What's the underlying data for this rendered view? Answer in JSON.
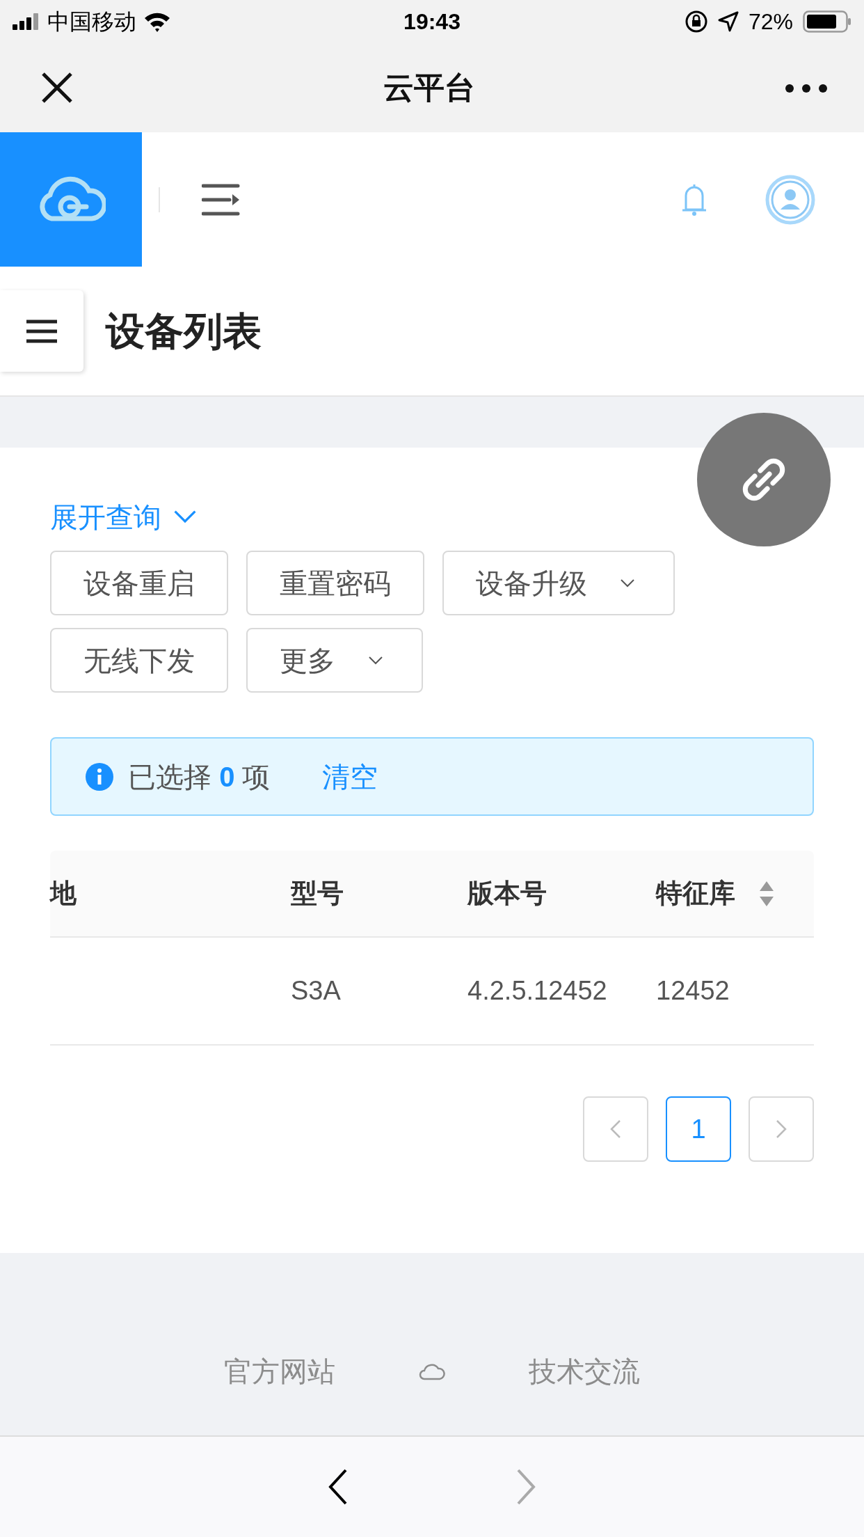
{
  "status_bar": {
    "carrier": "中国移动",
    "time": "19:43",
    "battery": "72%"
  },
  "nav_bar": {
    "title": "云平台"
  },
  "page": {
    "title": "设备列表"
  },
  "query_toggle": {
    "label": "展开查询",
    "expanded": false
  },
  "actions": [
    {
      "label": "设备重启",
      "kind": "button"
    },
    {
      "label": "重置密码",
      "kind": "button"
    },
    {
      "label": "设备升级",
      "kind": "dropdown"
    },
    {
      "label": "无线下发",
      "kind": "button"
    },
    {
      "label": "更多",
      "kind": "dropdown"
    }
  ],
  "selection_alert": {
    "prefix": "已选择",
    "count": "0",
    "suffix": "项",
    "clear": "清空"
  },
  "table": {
    "columns": [
      {
        "label": "地",
        "sortable": false
      },
      {
        "label": "型号",
        "sortable": false
      },
      {
        "label": "版本号",
        "sortable": false
      },
      {
        "label": "特征库",
        "sortable": true
      }
    ],
    "rows": [
      {
        "model": "S3A",
        "version": "4.2.5.12452",
        "signature": "12452"
      }
    ]
  },
  "pagination": {
    "pages": [
      {
        "label": "1",
        "selected": true
      }
    ]
  },
  "footer": {
    "links": [
      "官方网站",
      "技术交流"
    ]
  }
}
